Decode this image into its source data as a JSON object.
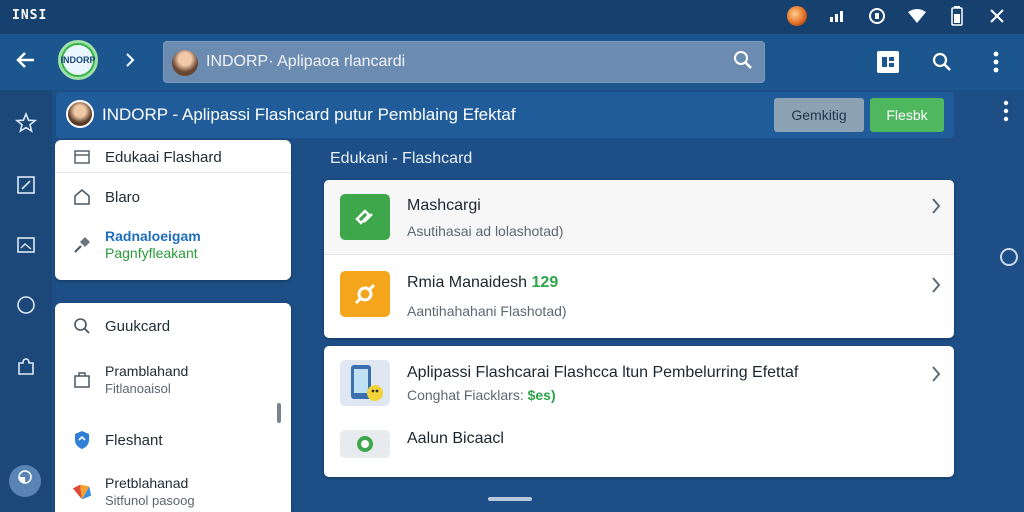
{
  "status_bar": {
    "logo_text": "INSI",
    "icons": [
      "avatar-icon",
      "signal-icon",
      "data-saver-icon",
      "wifi-icon",
      "battery-icon",
      "close-icon"
    ]
  },
  "app_bar": {
    "logo_text": "INDORP",
    "search": {
      "value": "INDORP· Aplipaoa rlancardi"
    }
  },
  "title_bar": {
    "title": "INDORP - Aplipassi Flashcard putur Pemblaing Efektaf",
    "bookmark_label": "Gemkitig",
    "flashcard_label": "Flesbk"
  },
  "panel1": {
    "header": "Edukaai  Flashard",
    "items": [
      {
        "label": "Blaro"
      },
      {
        "label": "Radnaloeigam",
        "sub": "Pagnfyfleakant"
      }
    ]
  },
  "panel2": {
    "items": [
      {
        "label": "Guukcard"
      },
      {
        "label": "Pramblahand",
        "sub": "Fitlanoaisol"
      },
      {
        "label": "Fleshant"
      },
      {
        "label": "Pretblahanad",
        "sub": "Sitfunol pasoog"
      }
    ]
  },
  "main": {
    "section_title": "Edukani - Flashcard",
    "card1_rows": [
      {
        "title": "Mashcargi",
        "sub": "Asutihasai ad lolashotad)"
      },
      {
        "title": "Rmia Manaidesh",
        "title_num": "129",
        "sub": "Aantihahahani Flashotad)"
      }
    ],
    "card2_rows": [
      {
        "title": "Aplipassi Flashcarai Flashcca ltun Pembelurring Efettaf",
        "sub": "Conghat Fiacklars:",
        "price": "$es)"
      },
      {
        "title": "Aalun Bicaacl"
      }
    ]
  },
  "colors": {
    "background": "#1d4f86",
    "accent_green": "#4fb85e",
    "accent_orange": "#f4a51c"
  }
}
